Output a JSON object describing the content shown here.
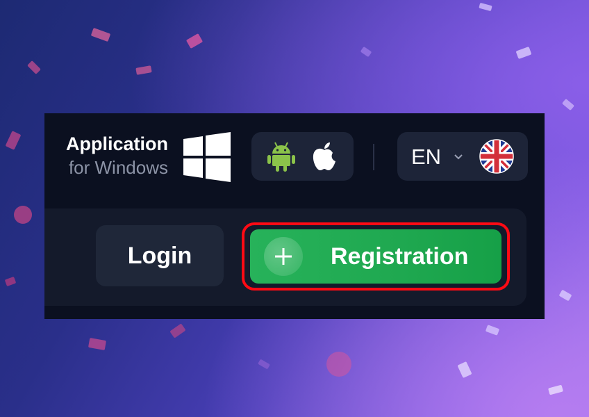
{
  "header": {
    "app_title": "Application",
    "app_subtitle": "for Windows",
    "windows_icon": "windows-icon",
    "mobile_apps": [
      {
        "platform": "Android",
        "icon": "android-icon",
        "color": "#8bc34a"
      },
      {
        "platform": "iOS",
        "icon": "apple-icon",
        "color": "#ffffff"
      }
    ],
    "language": {
      "code": "EN",
      "flag": "uk-flag-icon",
      "dropdown_icon": "chevron-down-icon"
    }
  },
  "auth": {
    "login_label": "Login",
    "registration_label": "Registration",
    "registration_icon": "plus-icon",
    "registration_color": "#1fa850",
    "highlight_color": "#ff0a14"
  },
  "colors": {
    "panel_bg": "#0b1020",
    "button_bg": "#1d2438"
  }
}
